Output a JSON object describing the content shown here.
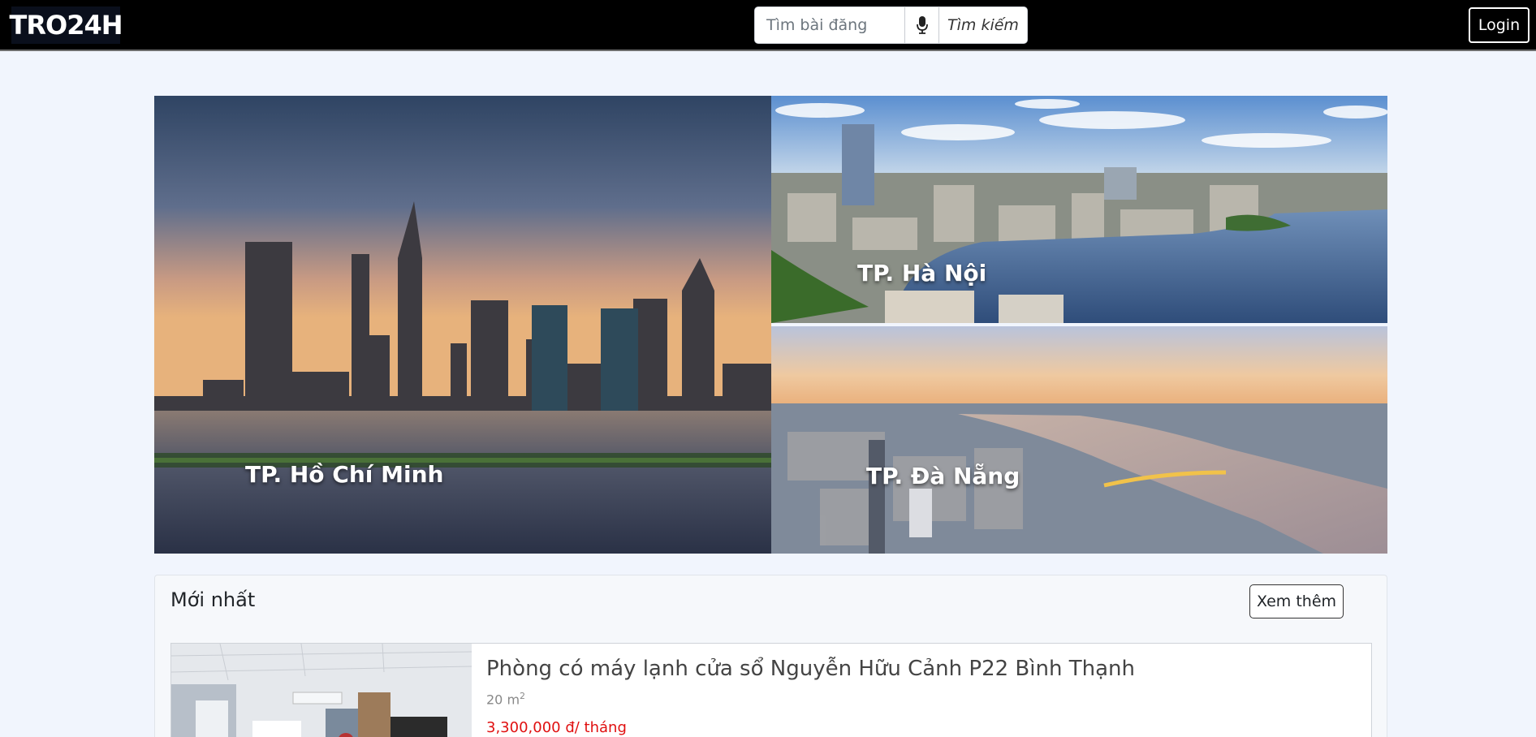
{
  "header": {
    "logo": "TRO24H",
    "search_placeholder": "Tìm bài đăng",
    "search_button": "Tìm kiếm",
    "login": "Login"
  },
  "cities": [
    {
      "name": "TP. Hồ Chí Minh"
    },
    {
      "name": "TP. Hà Nội"
    },
    {
      "name": "TP. Đà Nẵng"
    }
  ],
  "newest": {
    "title": "Mới nhất",
    "more_button": "Xem thêm",
    "listings": [
      {
        "title": "Phòng có máy lạnh cửa sổ Nguyễn Hữu Cảnh P22 Bình Thạnh",
        "area": "20 m",
        "area_sup": "2",
        "price": "3,300,000 đ/ tháng"
      }
    ]
  },
  "colors": {
    "header_bg": "#000000",
    "page_bg": "#f1f5fd",
    "price": "#e01010"
  }
}
